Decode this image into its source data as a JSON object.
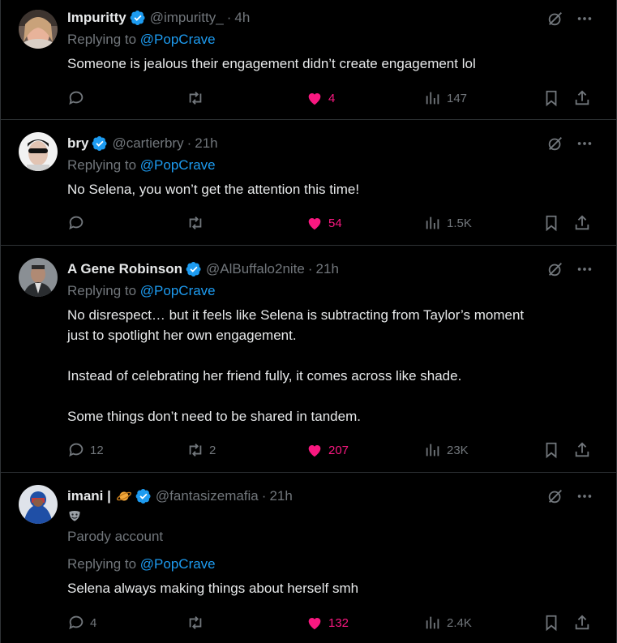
{
  "tweets": [
    {
      "name": "Impuritty",
      "handle": "@impuritty_",
      "dot": "·",
      "time": "4h",
      "replying_prefix": "Replying to ",
      "replying_to": "@PopCrave",
      "text": [
        "Someone is jealous their engagement didn’t create engagement lol"
      ],
      "replies": "",
      "retweets": "",
      "likes": "4",
      "views": "147"
    },
    {
      "name": "bry",
      "handle": "@cartierbry",
      "dot": "·",
      "time": "21h",
      "replying_prefix": "Replying to ",
      "replying_to": "@PopCrave",
      "text": [
        "No Selena, you won’t get the attention this time!"
      ],
      "replies": "",
      "retweets": "",
      "likes": "54",
      "views": "1.5K"
    },
    {
      "name": "A Gene Robinson",
      "handle": "@AlBuffalo2nite",
      "dot": "·",
      "time": "21h",
      "replying_prefix": "Replying to ",
      "replying_to": "@PopCrave",
      "text": [
        "No disrespect… but it feels like Selena is subtracting from Taylor’s moment",
        "just to spotlight her own engagement.",
        "",
        "Instead of celebrating her friend fully, it comes across like shade.",
        "",
        "Some things don’t need to be shared in tandem."
      ],
      "replies": "12",
      "retweets": "2",
      "likes": "207",
      "views": "23K"
    },
    {
      "name": "imani |",
      "handle": "@fantasizemafia",
      "dot": "·",
      "time": "21h",
      "parody_label": "Parody account",
      "replying_prefix": "Replying to ",
      "replying_to": "@PopCrave",
      "text": [
        "Selena always making things about herself smh"
      ],
      "replies": "4",
      "retweets": "",
      "likes": "132",
      "views": "2.4K"
    }
  ],
  "colors": {
    "background": "#000000",
    "text": "#e7e9ea",
    "muted": "#71767b",
    "link": "#1d9bf0",
    "like": "#f91880",
    "verified": "#1d9bf0",
    "divider": "#2f3336"
  },
  "icons": [
    "reply-icon",
    "retweet-icon",
    "heart-filled-icon",
    "views-icon",
    "bookmark-icon",
    "share-icon",
    "grok-icon",
    "more-icon",
    "verified-icon",
    "planet-emoji",
    "theater-masks-emoji"
  ]
}
